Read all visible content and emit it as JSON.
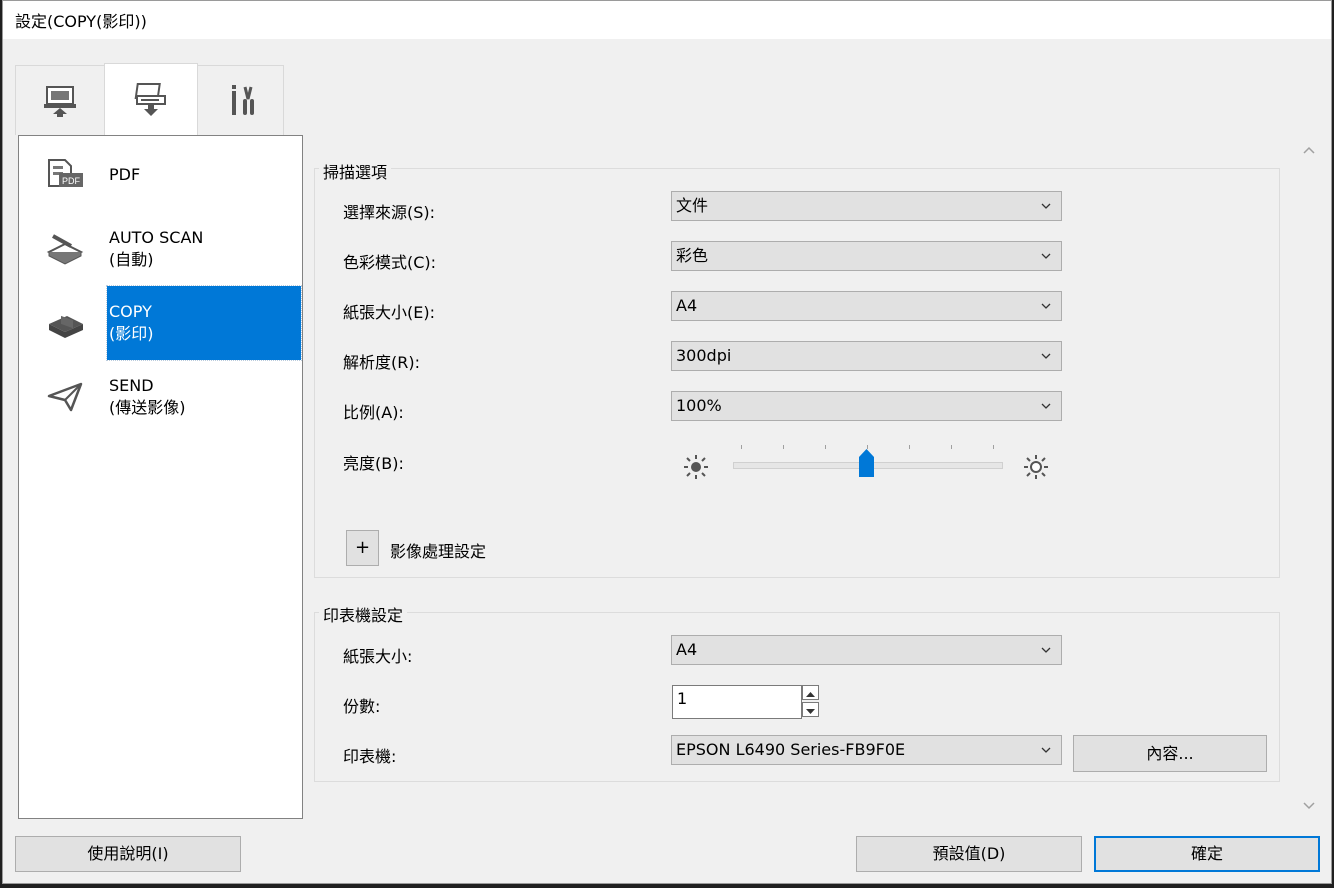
{
  "window": {
    "title": "設定(COPY(影印))"
  },
  "tabs": [
    {
      "icon": "computer-upload-icon"
    },
    {
      "icon": "scanner-download-icon"
    },
    {
      "icon": "tools-icon"
    }
  ],
  "modes": [
    {
      "icon": "pdf-icon",
      "line1": "PDF",
      "line2": ""
    },
    {
      "icon": "auto-scan-icon",
      "line1": "AUTO SCAN",
      "line2": "(自動)"
    },
    {
      "icon": "copy-icon",
      "line1": "COPY",
      "line2": "(影印)"
    },
    {
      "icon": "send-icon",
      "line1": "SEND",
      "line2": "(傳送影像)"
    }
  ],
  "scan_options": {
    "title": "掃描選項",
    "source_label": "選擇來源(S):",
    "source_value": "文件",
    "color_label": "色彩模式(C):",
    "color_value": "彩色",
    "paper_label": "紙張大小(E):",
    "paper_value": "A4",
    "resolution_label": "解析度(R):",
    "resolution_value": "300dpi",
    "scale_label": "比例(A):",
    "scale_value": "100%",
    "brightness_label": "亮度(B):",
    "image_processing_label": "影像處理設定",
    "plus_symbol": "+"
  },
  "printer_settings": {
    "title": "印表機設定",
    "paper_label": "紙張大小:",
    "paper_value": "A4",
    "copies_label": "份數:",
    "copies_value": "1",
    "printer_label": "印表機:",
    "printer_value": "EPSON L6490 Series-FB9F0E",
    "properties_button": "內容..."
  },
  "footer": {
    "help_button": "使用說明(I)",
    "default_button": "預設值(D)",
    "ok_button": "確定"
  },
  "colors": {
    "accent": "#0078d7",
    "panel": "#f0f0f0"
  }
}
